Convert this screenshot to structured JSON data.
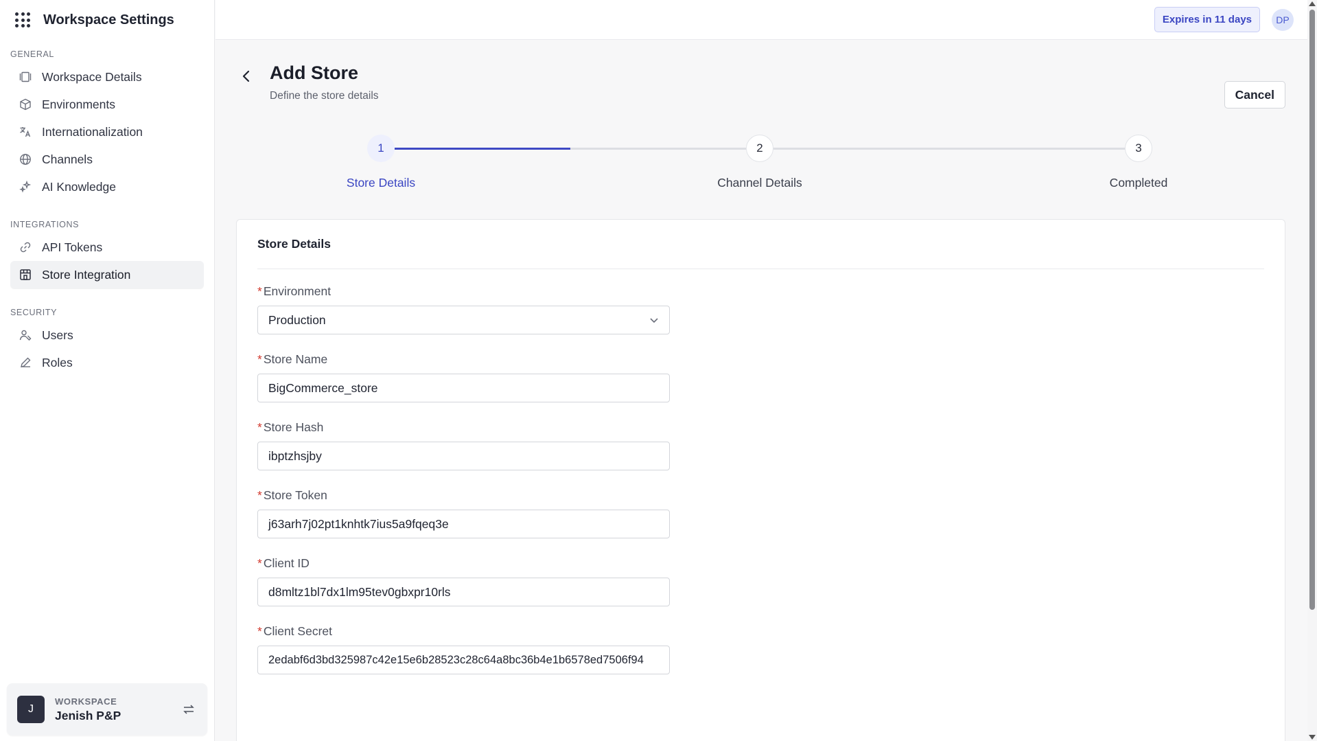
{
  "sidebar": {
    "title": "Workspace Settings",
    "sections": {
      "general": "GENERAL",
      "integrations": "INTEGRATIONS",
      "security": "SECURITY"
    },
    "items": {
      "workspace_details": "Workspace Details",
      "environments": "Environments",
      "internationalization": "Internationalization",
      "channels": "Channels",
      "ai_knowledge": "AI Knowledge",
      "api_tokens": "API Tokens",
      "store_integration": "Store Integration",
      "users": "Users",
      "roles": "Roles"
    },
    "active_item": "store_integration",
    "workspace": {
      "label": "WORKSPACE",
      "name": "Jenish P&P",
      "initial": "J"
    }
  },
  "topbar": {
    "expires": "Expires in 11 days",
    "avatar": "DP"
  },
  "page": {
    "title": "Add Store",
    "subtitle": "Define the store details",
    "cancel": "Cancel"
  },
  "stepper": {
    "steps": [
      {
        "number": "1",
        "label": "Store Details",
        "state": "active"
      },
      {
        "number": "2",
        "label": "Channel Details",
        "state": "pending"
      },
      {
        "number": "3",
        "label": "Completed",
        "state": "pending"
      }
    ],
    "progress_fraction": 0.5
  },
  "form": {
    "title": "Store Details",
    "required_mark": "*",
    "environment": {
      "label": "Environment",
      "value": "Production"
    },
    "store_name": {
      "label": "Store Name",
      "value": "BigCommerce_store"
    },
    "store_hash": {
      "label": "Store Hash",
      "value": "ibptzhsjby"
    },
    "store_token": {
      "label": "Store Token",
      "value": "j63arh7j02pt1knhtk7ius5a9fqeq3e"
    },
    "client_id": {
      "label": "Client ID",
      "value": "d8mltz1bl7dx1lm95tev0gbxpr10rls"
    },
    "client_secret": {
      "label": "Client Secret",
      "value": "2edabf6d3bd325987c42e15e6b28523c28c64a8bc36b4e1b6578ed7506f94"
    }
  },
  "colors": {
    "accent": "#3f49c4",
    "required": "#d23a2f"
  }
}
